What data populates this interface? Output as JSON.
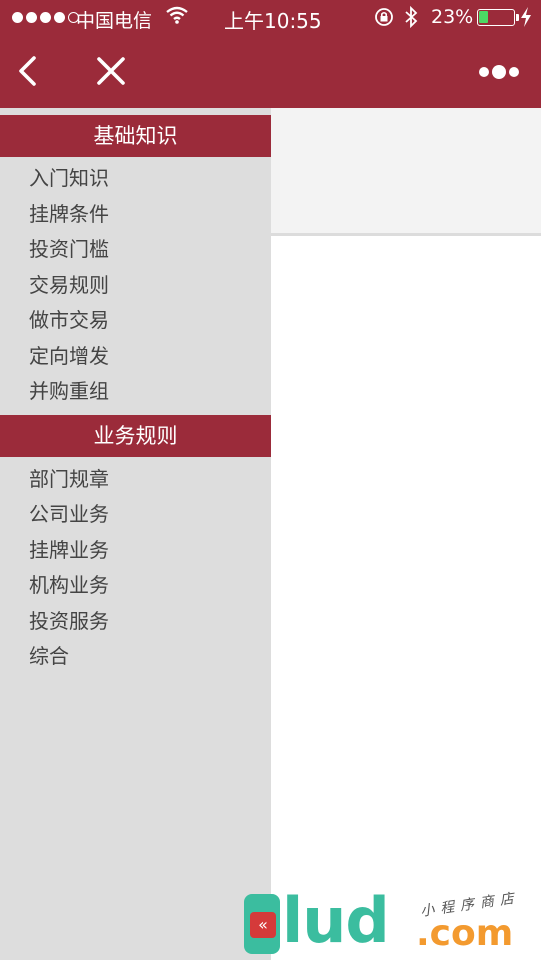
{
  "status_bar": {
    "carrier": "中国电信",
    "time": "上午10:55",
    "battery_percent": "23%",
    "battery_level": 0.23,
    "signal_strength": 4,
    "signal_max": 5
  },
  "nav": {
    "back_icon": "chevron-left-icon",
    "close_icon": "close-icon",
    "more_icon": "more-dots-icon"
  },
  "sidebar": {
    "sections": [
      {
        "title": "基础知识",
        "items": [
          "入门知识",
          "挂牌条件",
          "投资门槛",
          "交易规则",
          "做市交易",
          "定向增发",
          "并购重组"
        ]
      },
      {
        "title": "业务规则",
        "items": [
          "部门规章",
          "公司业务",
          "挂牌业务",
          "机构业务",
          "投资服务",
          "综合"
        ]
      }
    ]
  },
  "watermark": {
    "main": "lud",
    "domain": ".com",
    "slogan": "小程序商店"
  },
  "colors": {
    "brand": "#9b2b3a",
    "sidebar_bg": "#dddddd",
    "battery_fill": "#4cd964"
  }
}
